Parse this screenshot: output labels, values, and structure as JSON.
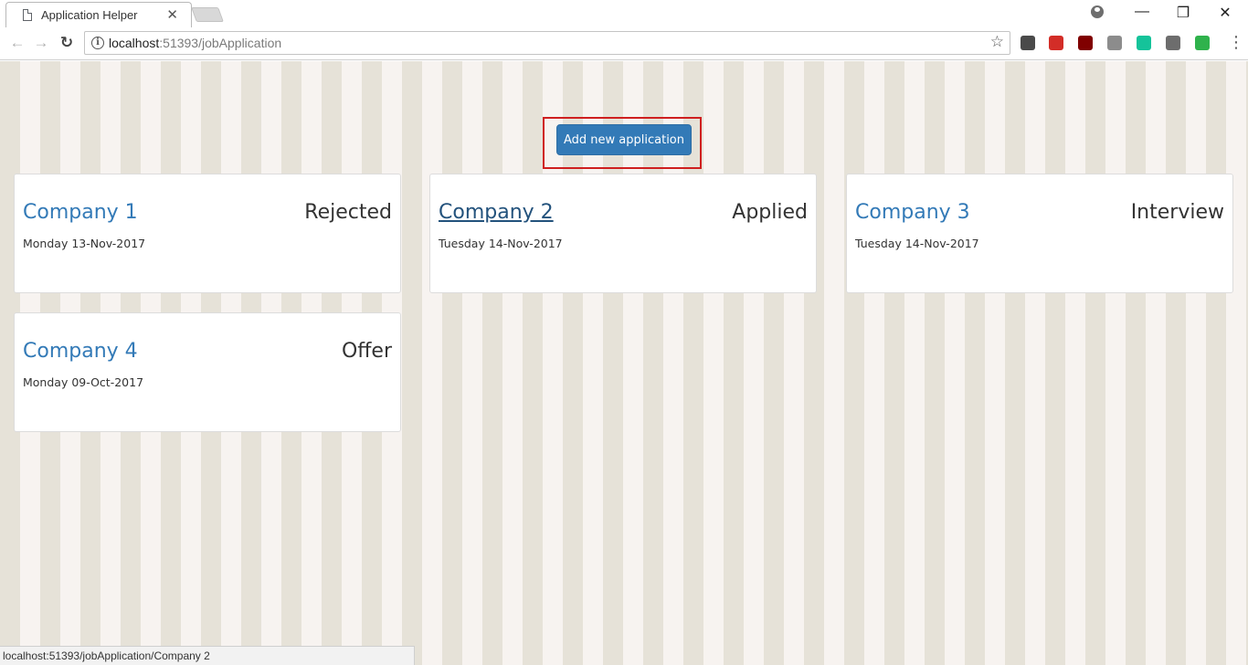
{
  "browser": {
    "tab_title": "Application Helper",
    "tab_close": "✕",
    "url_host": "localhost",
    "url_rest": ":51393/jobApplication",
    "back": "←",
    "forward": "→",
    "reload": "↻",
    "star": "☆",
    "menu": "⋮",
    "minimize": "—",
    "restore": "❐",
    "close": "✕",
    "status_url": "localhost:51393/jobApplication/Company 2",
    "extensions": [
      {
        "name": "evernote-icon",
        "color": "#4a4a4a"
      },
      {
        "name": "lastpass-icon",
        "color": "#d32d27"
      },
      {
        "name": "ublock-icon",
        "color": "#800000"
      },
      {
        "name": "extension-gray-icon",
        "color": "#8c8c8c"
      },
      {
        "name": "grammarly-icon",
        "color": "#15c39a"
      },
      {
        "name": "ghostery-icon",
        "color": "#6d6d6d"
      },
      {
        "name": "plus-extension-icon",
        "color": "#2fb24c"
      }
    ]
  },
  "page": {
    "add_button": "Add new application",
    "cards": [
      {
        "company": "Company 1",
        "status": "Rejected",
        "date": "Monday 13-Nov-2017"
      },
      {
        "company": "Company 2",
        "status": "Applied",
        "date": "Tuesday 14-Nov-2017"
      },
      {
        "company": "Company 3",
        "status": "Interview",
        "date": "Tuesday 14-Nov-2017"
      },
      {
        "company": "Company 4",
        "status": "Offer",
        "date": "Monday 09-Oct-2017"
      }
    ]
  }
}
